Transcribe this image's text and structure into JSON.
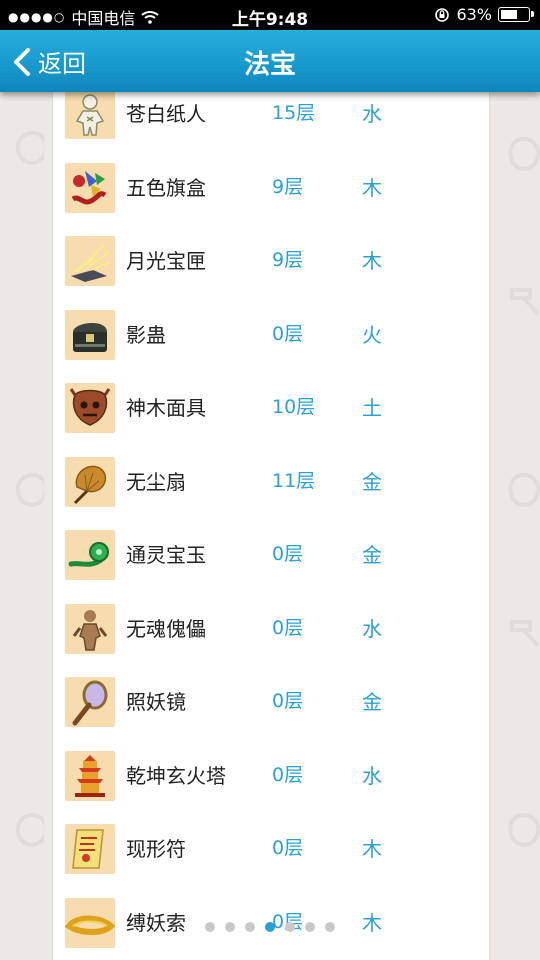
{
  "status_bar": {
    "carrier": "中国电信",
    "time": "上午9:48",
    "battery": "63%",
    "battery_level": 0.63
  },
  "nav": {
    "back_label": "返回",
    "title": "法宝"
  },
  "items": [
    {
      "name": "苍白纸人",
      "level": "15层",
      "element": "水",
      "icon": "paper-doll-icon"
    },
    {
      "name": "五色旗盒",
      "level": "9层",
      "element": "木",
      "icon": "flag-box-icon"
    },
    {
      "name": "月光宝匣",
      "level": "9层",
      "element": "木",
      "icon": "moonlight-box-icon"
    },
    {
      "name": "影蛊",
      "level": "0层",
      "element": "火",
      "icon": "shadow-chest-icon"
    },
    {
      "name": "神木面具",
      "level": "10层",
      "element": "土",
      "icon": "wood-mask-icon"
    },
    {
      "name": "无尘扇",
      "level": "11层",
      "element": "金",
      "icon": "fan-icon"
    },
    {
      "name": "通灵宝玉",
      "level": "0层",
      "element": "金",
      "icon": "jade-icon"
    },
    {
      "name": "无魂傀儡",
      "level": "0层",
      "element": "水",
      "icon": "puppet-icon"
    },
    {
      "name": "照妖镜",
      "level": "0层",
      "element": "金",
      "icon": "mirror-icon"
    },
    {
      "name": "乾坤玄火塔",
      "level": "0层",
      "element": "水",
      "icon": "fire-pagoda-icon"
    },
    {
      "name": "现形符",
      "level": "0层",
      "element": "木",
      "icon": "talisman-scroll-icon"
    },
    {
      "name": "缚妖索",
      "level": "0层",
      "element": "木",
      "icon": "rope-icon"
    }
  ],
  "pager": {
    "count": 7,
    "active_index": 3
  }
}
